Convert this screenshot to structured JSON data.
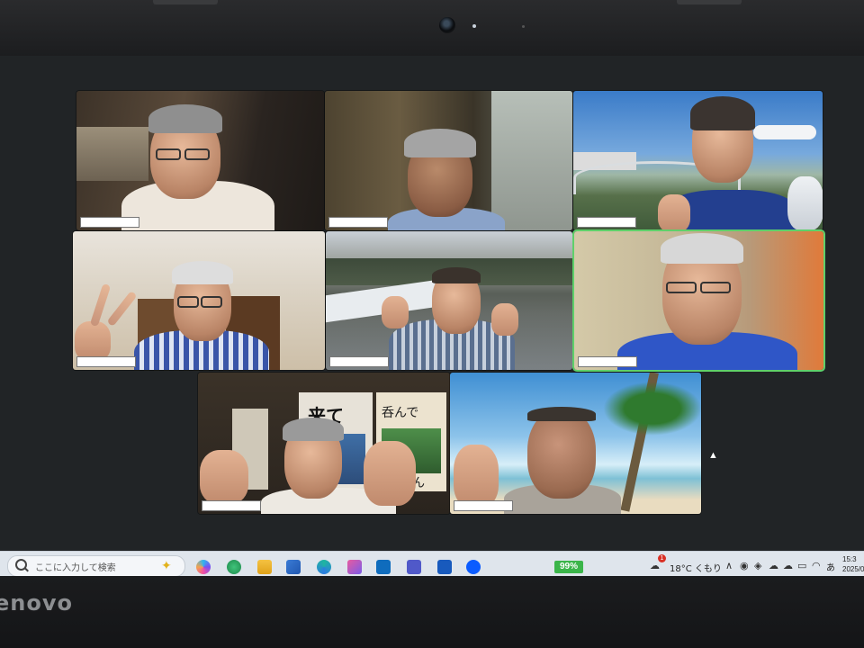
{
  "taskbar": {
    "search_placeholder": "ここに入力して検索",
    "battery": "99%",
    "weather": "18°C くもり",
    "clock_time": "15:3",
    "clock_date": "2025/0",
    "notification_count": "1",
    "ime": "あ"
  },
  "tiles": [
    {
      "name_tag": ""
    },
    {
      "name_tag": ""
    },
    {
      "name_tag": ""
    },
    {
      "name_tag": ""
    },
    {
      "name_tag": ""
    },
    {
      "name_tag": ""
    },
    {
      "name_tag": ""
    },
    {
      "name_tag": ""
    }
  ],
  "posters": {
    "poster_1": "来て",
    "poster_2": "呑んで",
    "poster_3": "ん"
  },
  "laptop": {
    "brand": "enovo"
  },
  "colors": {
    "active_speaker_border": "#5fd06a",
    "battery": "#3bb54a"
  }
}
